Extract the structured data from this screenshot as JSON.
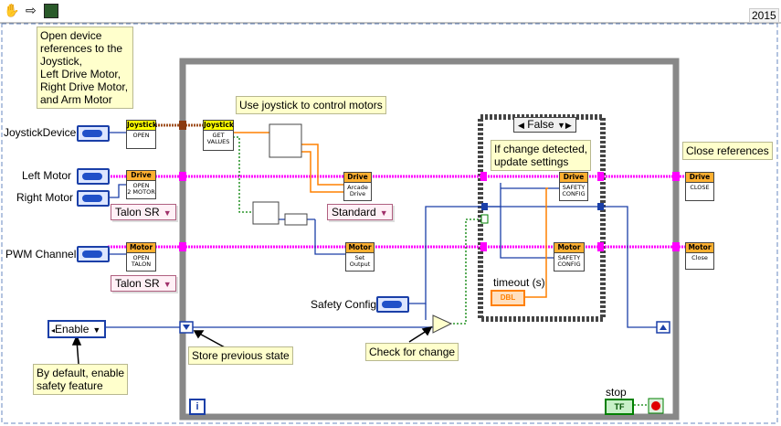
{
  "toolbar": {
    "run_arrow": "⇨",
    "hand": "✋",
    "year": "2015"
  },
  "comments": {
    "open_refs": "Open device\nreferences to the\nJoystick,\nLeft Drive Motor,\nRight Drive Motor,\nand Arm Motor",
    "use_joystick": "Use joystick to control motors",
    "if_change": "If change detected,\nupdate settings",
    "close_refs": "Close references",
    "store_prev": "Store previous state",
    "check_change": "Check for change",
    "default_enable": "By default, enable\nsafety feature"
  },
  "controls": {
    "joystick_device": "JoystickDevice",
    "left_motor": "Left Motor",
    "right_motor": "Right Motor",
    "pwm_channel": "PWM Channel",
    "safety_config": "Safety Config",
    "timeout": "timeout (s)",
    "stop": "stop",
    "enable": "Enable",
    "talon_a": "Talon SR",
    "talon_b": "Talon SR",
    "standard": "Standard",
    "dbl": "DBL",
    "tf": "TF",
    "case": "False",
    "info": "i"
  },
  "subvis": {
    "js_open": {
      "hd": "Joystick",
      "bd": "OPEN"
    },
    "js_get": {
      "hd": "Joystick",
      "bd": "GET\nVALUES"
    },
    "drive_open": {
      "hd": "Drive",
      "bd": "OPEN\n2 MOTOR"
    },
    "drive_arcade": {
      "hd": "Drive",
      "bd": "Arcade\nDrive"
    },
    "drive_safety": {
      "hd": "Drive",
      "bd": "SAFETY\nCONFIG"
    },
    "drive_close": {
      "hd": "Drive",
      "bd": "CLOSE"
    },
    "motor_open": {
      "hd": "Motor",
      "bd": "OPEN\nTALON"
    },
    "motor_set": {
      "hd": "Motor",
      "bd": "Set\nOutput"
    },
    "motor_safety": {
      "hd": "Motor",
      "bd": "SAFETY\nCONFIG"
    },
    "motor_close": {
      "hd": "Motor",
      "bd": "Close"
    }
  },
  "colors": {
    "wire_ref": "#ff00ff",
    "wire_blue": "#1a3fa8",
    "wire_orange": "#ff8000",
    "wire_green": "#008000",
    "loop": "#7a7a7a"
  }
}
